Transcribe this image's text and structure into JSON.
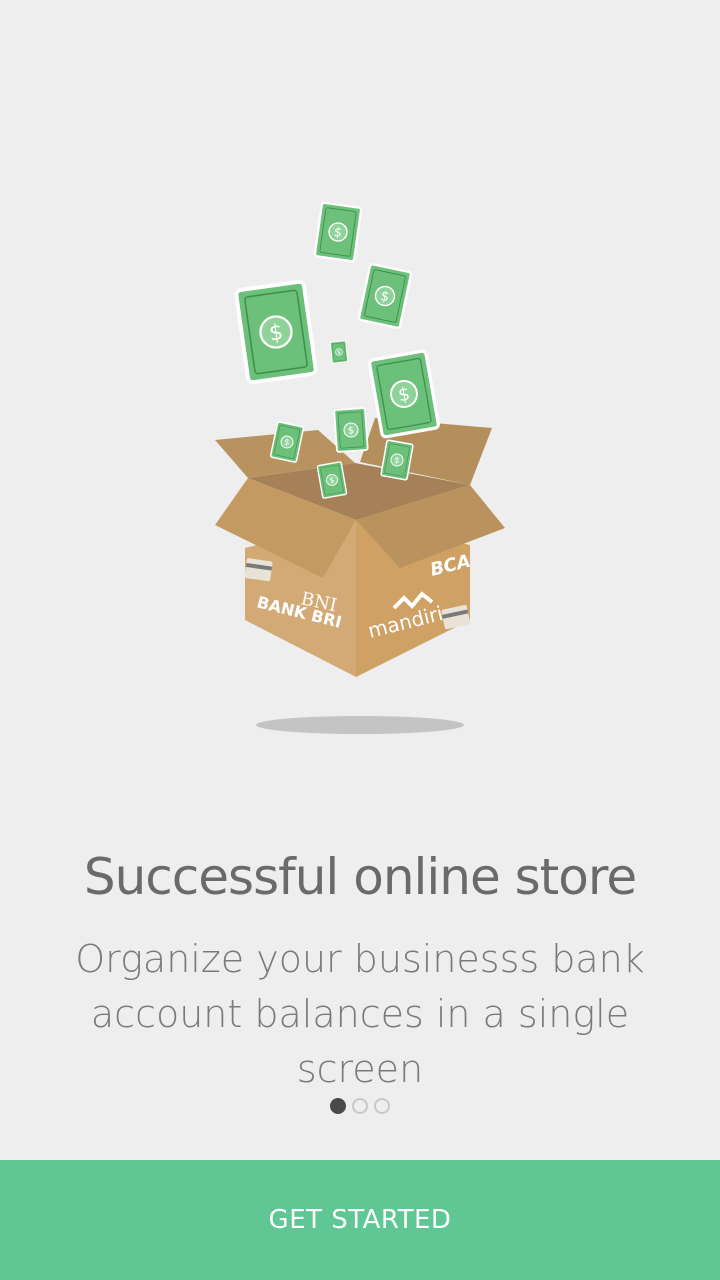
{
  "onboarding": {
    "title": "Successful online store",
    "subtitle_line1": "Organize your businesss bank",
    "subtitle_line2": "account balances in a single screen",
    "page_count": 3,
    "current_page": 1,
    "cta_label": "GET STARTED"
  },
  "illustration": {
    "bank_logos": [
      "BNI",
      "BANK BRI",
      "BCA",
      "mandiri"
    ],
    "money_symbol": "$"
  },
  "colors": {
    "background": "#eeeeee",
    "accent": "#5ec794",
    "cash_green": "#6cc07a",
    "box_tan": "#c9a36e"
  }
}
